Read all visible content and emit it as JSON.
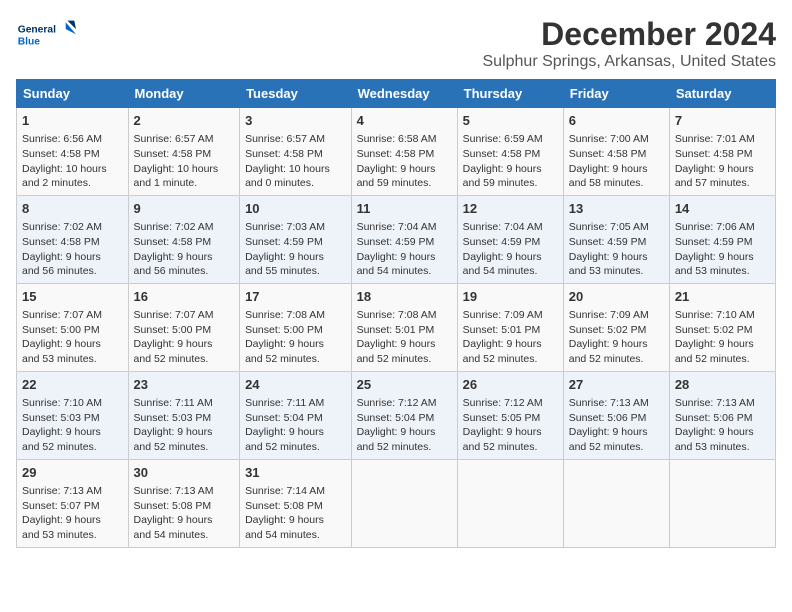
{
  "logo": {
    "line1": "General",
    "line2": "Blue"
  },
  "title": "December 2024",
  "subtitle": "Sulphur Springs, Arkansas, United States",
  "weekdays": [
    "Sunday",
    "Monday",
    "Tuesday",
    "Wednesday",
    "Thursday",
    "Friday",
    "Saturday"
  ],
  "weeks": [
    [
      {
        "day": "1",
        "lines": [
          "Sunrise: 6:56 AM",
          "Sunset: 4:58 PM",
          "Daylight: 10 hours",
          "and 2 minutes."
        ]
      },
      {
        "day": "2",
        "lines": [
          "Sunrise: 6:57 AM",
          "Sunset: 4:58 PM",
          "Daylight: 10 hours",
          "and 1 minute."
        ]
      },
      {
        "day": "3",
        "lines": [
          "Sunrise: 6:57 AM",
          "Sunset: 4:58 PM",
          "Daylight: 10 hours",
          "and 0 minutes."
        ]
      },
      {
        "day": "4",
        "lines": [
          "Sunrise: 6:58 AM",
          "Sunset: 4:58 PM",
          "Daylight: 9 hours",
          "and 59 minutes."
        ]
      },
      {
        "day": "5",
        "lines": [
          "Sunrise: 6:59 AM",
          "Sunset: 4:58 PM",
          "Daylight: 9 hours",
          "and 59 minutes."
        ]
      },
      {
        "day": "6",
        "lines": [
          "Sunrise: 7:00 AM",
          "Sunset: 4:58 PM",
          "Daylight: 9 hours",
          "and 58 minutes."
        ]
      },
      {
        "day": "7",
        "lines": [
          "Sunrise: 7:01 AM",
          "Sunset: 4:58 PM",
          "Daylight: 9 hours",
          "and 57 minutes."
        ]
      }
    ],
    [
      {
        "day": "8",
        "lines": [
          "Sunrise: 7:02 AM",
          "Sunset: 4:58 PM",
          "Daylight: 9 hours",
          "and 56 minutes."
        ]
      },
      {
        "day": "9",
        "lines": [
          "Sunrise: 7:02 AM",
          "Sunset: 4:58 PM",
          "Daylight: 9 hours",
          "and 56 minutes."
        ]
      },
      {
        "day": "10",
        "lines": [
          "Sunrise: 7:03 AM",
          "Sunset: 4:59 PM",
          "Daylight: 9 hours",
          "and 55 minutes."
        ]
      },
      {
        "day": "11",
        "lines": [
          "Sunrise: 7:04 AM",
          "Sunset: 4:59 PM",
          "Daylight: 9 hours",
          "and 54 minutes."
        ]
      },
      {
        "day": "12",
        "lines": [
          "Sunrise: 7:04 AM",
          "Sunset: 4:59 PM",
          "Daylight: 9 hours",
          "and 54 minutes."
        ]
      },
      {
        "day": "13",
        "lines": [
          "Sunrise: 7:05 AM",
          "Sunset: 4:59 PM",
          "Daylight: 9 hours",
          "and 53 minutes."
        ]
      },
      {
        "day": "14",
        "lines": [
          "Sunrise: 7:06 AM",
          "Sunset: 4:59 PM",
          "Daylight: 9 hours",
          "and 53 minutes."
        ]
      }
    ],
    [
      {
        "day": "15",
        "lines": [
          "Sunrise: 7:07 AM",
          "Sunset: 5:00 PM",
          "Daylight: 9 hours",
          "and 53 minutes."
        ]
      },
      {
        "day": "16",
        "lines": [
          "Sunrise: 7:07 AM",
          "Sunset: 5:00 PM",
          "Daylight: 9 hours",
          "and 52 minutes."
        ]
      },
      {
        "day": "17",
        "lines": [
          "Sunrise: 7:08 AM",
          "Sunset: 5:00 PM",
          "Daylight: 9 hours",
          "and 52 minutes."
        ]
      },
      {
        "day": "18",
        "lines": [
          "Sunrise: 7:08 AM",
          "Sunset: 5:01 PM",
          "Daylight: 9 hours",
          "and 52 minutes."
        ]
      },
      {
        "day": "19",
        "lines": [
          "Sunrise: 7:09 AM",
          "Sunset: 5:01 PM",
          "Daylight: 9 hours",
          "and 52 minutes."
        ]
      },
      {
        "day": "20",
        "lines": [
          "Sunrise: 7:09 AM",
          "Sunset: 5:02 PM",
          "Daylight: 9 hours",
          "and 52 minutes."
        ]
      },
      {
        "day": "21",
        "lines": [
          "Sunrise: 7:10 AM",
          "Sunset: 5:02 PM",
          "Daylight: 9 hours",
          "and 52 minutes."
        ]
      }
    ],
    [
      {
        "day": "22",
        "lines": [
          "Sunrise: 7:10 AM",
          "Sunset: 5:03 PM",
          "Daylight: 9 hours",
          "and 52 minutes."
        ]
      },
      {
        "day": "23",
        "lines": [
          "Sunrise: 7:11 AM",
          "Sunset: 5:03 PM",
          "Daylight: 9 hours",
          "and 52 minutes."
        ]
      },
      {
        "day": "24",
        "lines": [
          "Sunrise: 7:11 AM",
          "Sunset: 5:04 PM",
          "Daylight: 9 hours",
          "and 52 minutes."
        ]
      },
      {
        "day": "25",
        "lines": [
          "Sunrise: 7:12 AM",
          "Sunset: 5:04 PM",
          "Daylight: 9 hours",
          "and 52 minutes."
        ]
      },
      {
        "day": "26",
        "lines": [
          "Sunrise: 7:12 AM",
          "Sunset: 5:05 PM",
          "Daylight: 9 hours",
          "and 52 minutes."
        ]
      },
      {
        "day": "27",
        "lines": [
          "Sunrise: 7:13 AM",
          "Sunset: 5:06 PM",
          "Daylight: 9 hours",
          "and 52 minutes."
        ]
      },
      {
        "day": "28",
        "lines": [
          "Sunrise: 7:13 AM",
          "Sunset: 5:06 PM",
          "Daylight: 9 hours",
          "and 53 minutes."
        ]
      }
    ],
    [
      {
        "day": "29",
        "lines": [
          "Sunrise: 7:13 AM",
          "Sunset: 5:07 PM",
          "Daylight: 9 hours",
          "and 53 minutes."
        ]
      },
      {
        "day": "30",
        "lines": [
          "Sunrise: 7:13 AM",
          "Sunset: 5:08 PM",
          "Daylight: 9 hours",
          "and 54 minutes."
        ]
      },
      {
        "day": "31",
        "lines": [
          "Sunrise: 7:14 AM",
          "Sunset: 5:08 PM",
          "Daylight: 9 hours",
          "and 54 minutes."
        ]
      },
      {
        "day": "",
        "lines": []
      },
      {
        "day": "",
        "lines": []
      },
      {
        "day": "",
        "lines": []
      },
      {
        "day": "",
        "lines": []
      }
    ]
  ]
}
